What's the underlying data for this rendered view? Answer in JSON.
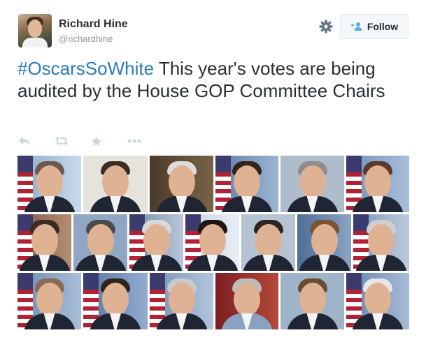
{
  "author": {
    "name": "Richard Hine",
    "handle": "@richardhine"
  },
  "follow_button": {
    "label": "Follow"
  },
  "tweet": {
    "hashtag": "#OscarsSoWhite",
    "text": " This year's votes are being audited by the House GOP Committee Chairs"
  },
  "actions": [
    {
      "icon": "reply-icon"
    },
    {
      "icon": "retweet-icon"
    },
    {
      "icon": "favorite-star-icon"
    },
    {
      "icon": "more-dots-icon"
    }
  ],
  "photo_grid": {
    "rows": [
      {
        "count": 6
      },
      {
        "count": 7
      },
      {
        "count": 6
      }
    ]
  },
  "colors": {
    "hashtag": "#2b7bb9",
    "text": "#292f33",
    "muted": "#8899a6",
    "follow_icon": "#55acee",
    "action_icons": "#ccd6dd"
  }
}
